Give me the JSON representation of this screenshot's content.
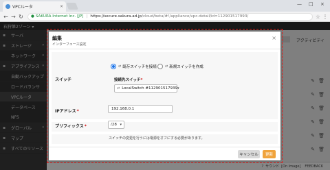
{
  "browser": {
    "tab_title": "VPCルータ",
    "tab_close": "×",
    "win_controls": [
      "—",
      "□",
      "×"
    ],
    "secure_label": "SAKURA Internet Inc. [JP]",
    "url_host": "https://secure.sakura.ad.jp",
    "url_path": "/cloud/beta/#!/appliance/vpc-detail/id=112901517993/",
    "back": "←",
    "forward": "→",
    "reload": "↻",
    "star": "☆",
    "menu": "⋮"
  },
  "app": {
    "zone": "石狩第2ゾーン ▾",
    "sidebar": [
      {
        "label": "サーバ",
        "icon": "▪",
        "sub": false,
        "active": false,
        "caret": ""
      },
      {
        "label": "ストレージ",
        "icon": "▪",
        "sub": false,
        "active": false,
        "caret": "▾"
      },
      {
        "label": "ネットワーク",
        "icon": "",
        "sub": true,
        "active": false,
        "caret": "▾"
      },
      {
        "label": "アプライアンス",
        "icon": "▪",
        "sub": false,
        "active": false,
        "caret": "▾"
      },
      {
        "label": "自動バックアップ",
        "icon": "",
        "sub": true,
        "active": false,
        "caret": ""
      },
      {
        "label": "ロードバランサ",
        "icon": "",
        "sub": true,
        "active": false,
        "caret": ""
      },
      {
        "label": "VPCルータ",
        "icon": "",
        "sub": true,
        "active": true,
        "caret": ""
      },
      {
        "label": "データベース",
        "icon": "",
        "sub": true,
        "active": false,
        "caret": ""
      },
      {
        "label": "NFS",
        "icon": "",
        "sub": true,
        "active": false,
        "caret": ""
      },
      {
        "label": "グローバル",
        "icon": "▪",
        "sub": false,
        "active": false,
        "caret": "▾"
      },
      {
        "label": "マップ",
        "icon": "▪",
        "sub": false,
        "active": false,
        "caret": ""
      },
      {
        "label": "すべてのリソース",
        "icon": "▪",
        "sub": false,
        "active": false,
        "caret": ""
      }
    ],
    "activity": "アクティビティ",
    "footer": {
      "help_icon": "?",
      "support": "サウンド",
      "image": "[On Image]",
      "feedback": "FEEDBACK"
    }
  },
  "modal": {
    "title": "編集",
    "subtitle": "インターフェース設定",
    "close": "×",
    "switch_label": "スイッチ",
    "radio_existing": "既存スイッチを接続",
    "radio_new": "新規スイッチを作成",
    "connect_label": "接続先スイッチ",
    "required_mark": "*",
    "switch_value": "LocalSwitch #112901517939",
    "ip_label": "IPアドレス",
    "ip_value": "192.168.0.1",
    "prefix_label": "プリフィックス",
    "prefix_value": "/28",
    "hint": "スイッチの変更を行うには電源をオフにする必要があります。",
    "cancel": "キャンセル",
    "ok": "更新"
  }
}
